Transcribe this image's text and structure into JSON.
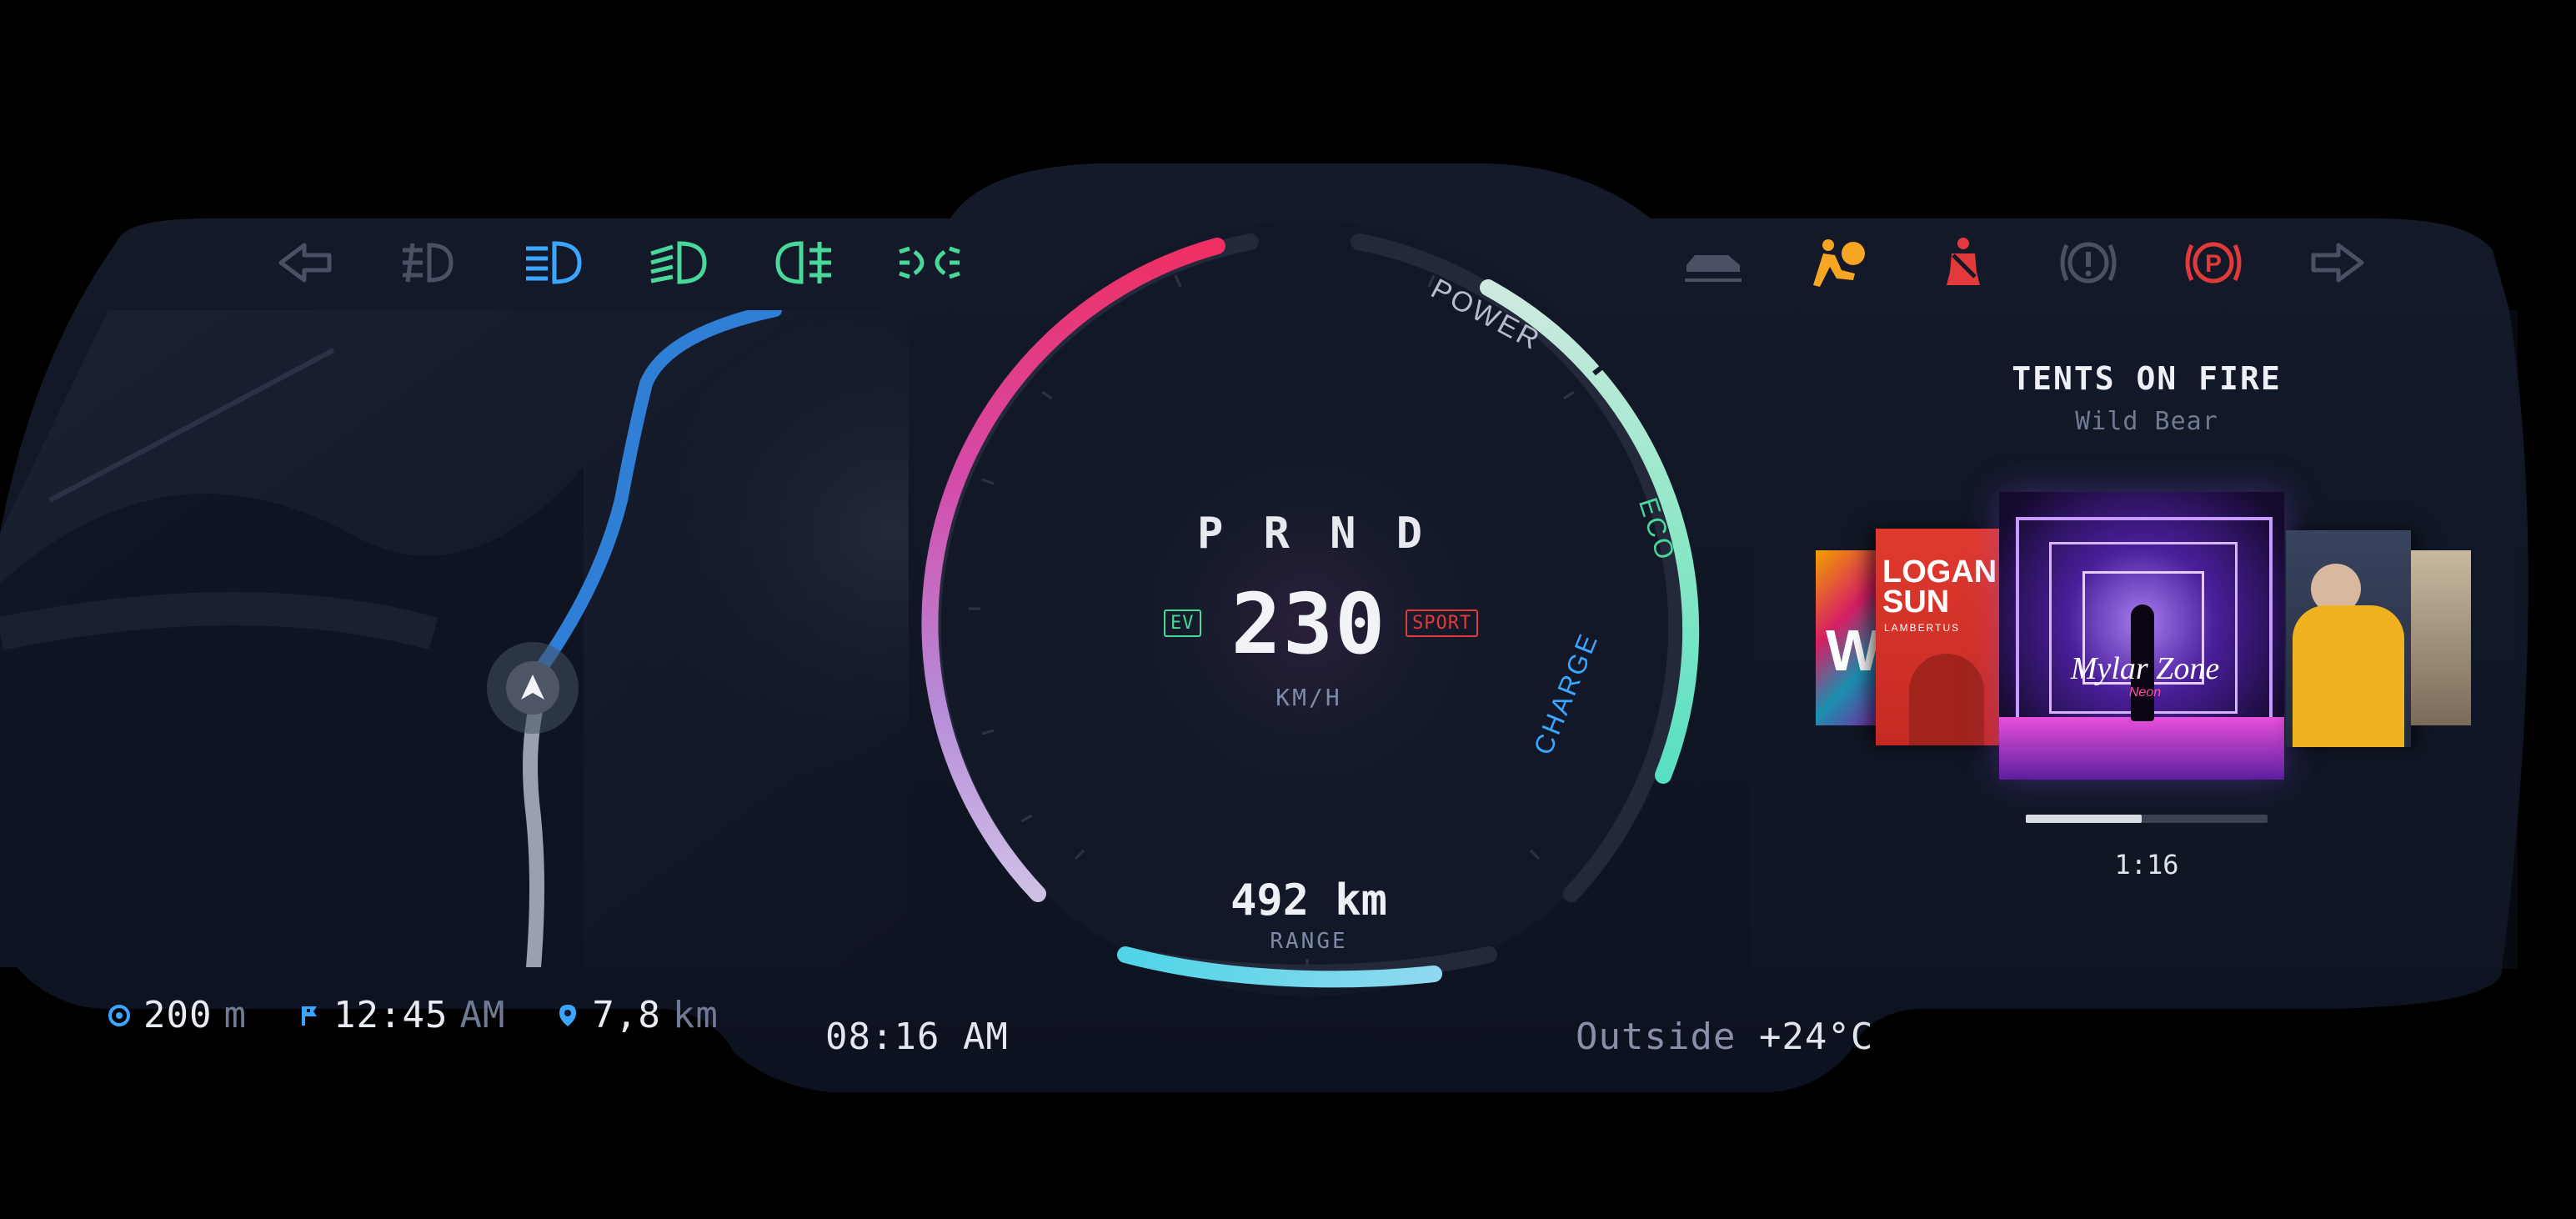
{
  "colors": {
    "panel": "#111726",
    "accent_blue": "#2f7fd6",
    "accent_teal": "#6be3c2",
    "accent_pink": "#e8336f",
    "warning_orange": "#f5a623",
    "warning_red": "#e23a3a"
  },
  "indicators_left": [
    {
      "icon": "turn-left-arrow-icon",
      "color": "#4a5165"
    },
    {
      "icon": "fog-light-rear-icon",
      "color": "#4a5165"
    },
    {
      "icon": "low-beam-icon",
      "color": "#3aa6ff"
    },
    {
      "icon": "high-beam-icon",
      "color": "#48d89a"
    },
    {
      "icon": "front-fog-light-icon",
      "color": "#48d89a"
    },
    {
      "icon": "parking-light-icon",
      "color": "#48d89a"
    }
  ],
  "indicators_right": [
    {
      "icon": "car-lowered-icon",
      "color": "#4a5165"
    },
    {
      "icon": "airbag-icon",
      "color": "#f5a623"
    },
    {
      "icon": "seatbelt-icon",
      "color": "#e23a3a"
    },
    {
      "icon": "brake-warning-icon",
      "color": "#4a5165"
    },
    {
      "icon": "parking-brake-icon",
      "color": "#e23a3a"
    },
    {
      "icon": "turn-right-arrow-icon",
      "color": "#4a5165"
    }
  ],
  "gauge": {
    "gears": [
      "P",
      "R",
      "N",
      "D"
    ],
    "speed": "230",
    "unit": "KM/H",
    "ev_badge": "EV",
    "sport_badge": "SPORT",
    "power_label": "POWER",
    "eco_label": "ECO",
    "charge_label": "CHARGE",
    "range_value": "492 km",
    "range_label": "RANGE",
    "range_level": 0.85
  },
  "nav": {
    "distance_value": "200",
    "distance_unit": "m",
    "eta_value": "12:45",
    "eta_unit": "AM",
    "remaining_value": "7,8",
    "remaining_unit": "km"
  },
  "clock": "08:16 AM",
  "weather": {
    "label": "Outside",
    "temp": "+24°C"
  },
  "media": {
    "title": "TENTS ON FIRE",
    "artist": "Wild Bear",
    "time": "1:16",
    "progress": 0.48,
    "cover_left_text": "LOGAN SUN",
    "cover_left_sub": "LAMBERTUS",
    "cover_center_text": "Mylar Zone",
    "cover_center_sub": "Neon"
  }
}
